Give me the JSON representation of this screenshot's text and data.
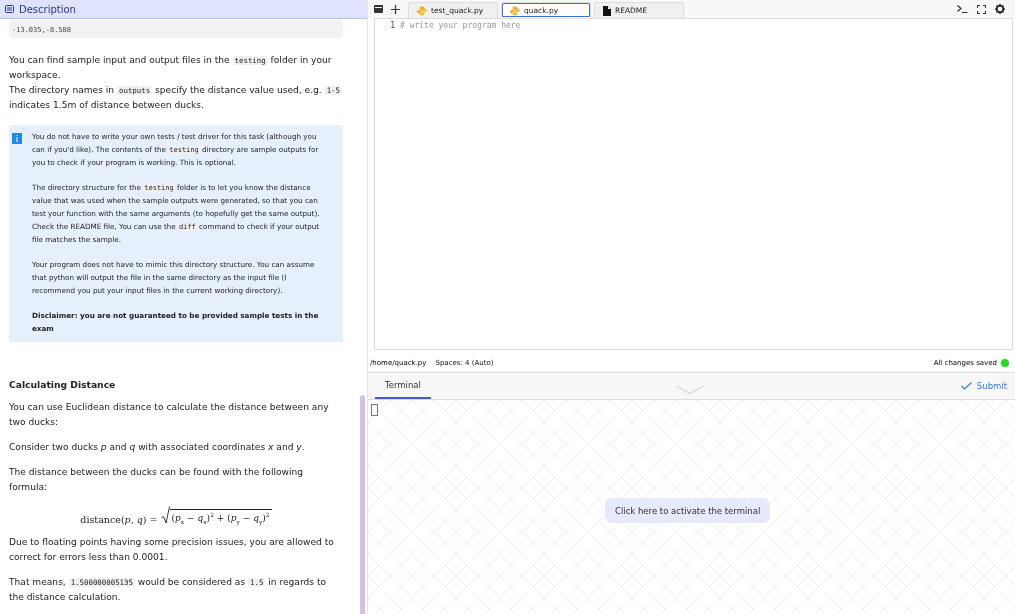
{
  "description_header": {
    "title": "Description"
  },
  "code_block": {
    "lines": [
      "-13.035,-8.588"
    ]
  },
  "intro": [
    {
      "segments": [
        {
          "kind": "text",
          "text": "You can find sample input and output files in the "
        },
        {
          "kind": "code",
          "text": "testing"
        },
        {
          "kind": "text",
          "text": " folder in your workspace."
        }
      ]
    },
    {
      "segments": [
        {
          "kind": "text",
          "text": "The directory names in "
        },
        {
          "kind": "code",
          "text": "outputs"
        },
        {
          "kind": "text",
          "text": " specify the distance value used, e.g. "
        },
        {
          "kind": "code",
          "text": "1-5"
        },
        {
          "kind": "text",
          "text": " indicates 1.5m of distance between ducks."
        }
      ]
    }
  ],
  "info_box": {
    "icon": "i",
    "paragraphs": [
      {
        "kind": "normal",
        "segments": [
          {
            "kind": "text",
            "text": "You do not have to write your own tests / test driver for this task (although you can if you'd like). The contents of the "
          },
          {
            "kind": "code",
            "text": "testing"
          },
          {
            "kind": "text",
            "text": " directory are sample outputs for you to check if your program is working. This is optional."
          }
        ]
      },
      {
        "kind": "normal",
        "segments": [
          {
            "kind": "text",
            "text": "The directory structure for the "
          },
          {
            "kind": "code",
            "text": "testing"
          },
          {
            "kind": "text",
            "text": " folder is to let you know the distance value that was used when the sample outputs were generated, so that you can test your function with the same arguments (to hopefully get the same output). Check the README file, You can use the "
          },
          {
            "kind": "code",
            "text": "diff"
          },
          {
            "kind": "text",
            "text": " command to check if your output file matches the sample."
          }
        ]
      },
      {
        "kind": "normal",
        "segments": [
          {
            "kind": "text",
            "text": "Your program does not have to mimic this directory structure. You can assume that python will output the file in the same directory as the input file (I recommend you put your input files in the current working directory)."
          }
        ]
      },
      {
        "kind": "bold",
        "segments": [
          {
            "kind": "text",
            "text": "Disclaimer: you are not guaranteed to be provided sample tests in the exam"
          }
        ]
      }
    ]
  },
  "section_heading": "Calculating Distance",
  "body": [
    {
      "kind": "para",
      "segments": [
        {
          "kind": "text",
          "text": "You can use Euclidean distance to calculate the distance between any two ducks:"
        }
      ]
    },
    {
      "kind": "para",
      "segments": [
        {
          "kind": "text",
          "text": "Consider two ducks *p* and *q* with associated coordinates *x* and *y*."
        }
      ]
    },
    {
      "kind": "para",
      "segments": [
        {
          "kind": "text",
          "text": "The distance between the ducks can be found with the following formula:"
        }
      ]
    },
    {
      "kind": "formula",
      "lhs": "distance(*p*, *q*) =",
      "radicand": "(*p*$_{x}$ − *q*$_{x}$)$^{2}$ + (*p*$_{y}$ − *q*$_{y}$)$^{2}$"
    },
    {
      "kind": "para",
      "segments": [
        {
          "kind": "text",
          "text": "Due to floating points having some precision issues, you are allowed to correct for errors less than 0.0001."
        }
      ]
    },
    {
      "kind": "para",
      "segments": [
        {
          "kind": "text",
          "text": "That means, "
        },
        {
          "kind": "code",
          "text": "1.500000005135"
        },
        {
          "kind": "text",
          "text": " would be considered as "
        },
        {
          "kind": "code",
          "text": "1.5"
        },
        {
          "kind": "text",
          "text": " in regards to the distance calculation."
        }
      ]
    }
  ],
  "editor_tabs": [
    {
      "label": "test_quack.py",
      "kind": "python",
      "selected": false
    },
    {
      "label": "quack.py",
      "kind": "python",
      "selected": true
    },
    {
      "label": "README",
      "kind": "file",
      "selected": false
    }
  ],
  "editor": {
    "lines": [
      {
        "number": "1",
        "code": "# write your program here"
      }
    ]
  },
  "status_bar": {
    "path": "/home/quack.py",
    "indent": "Spaces: 4 (Auto)",
    "save_status": "All changes saved",
    "saved": true
  },
  "bottom_tabs": [
    {
      "label": "Terminal",
      "selected": true
    }
  ],
  "submit_button": "Submit",
  "terminal": {
    "activate_button": "Click here to activate the terminal"
  }
}
